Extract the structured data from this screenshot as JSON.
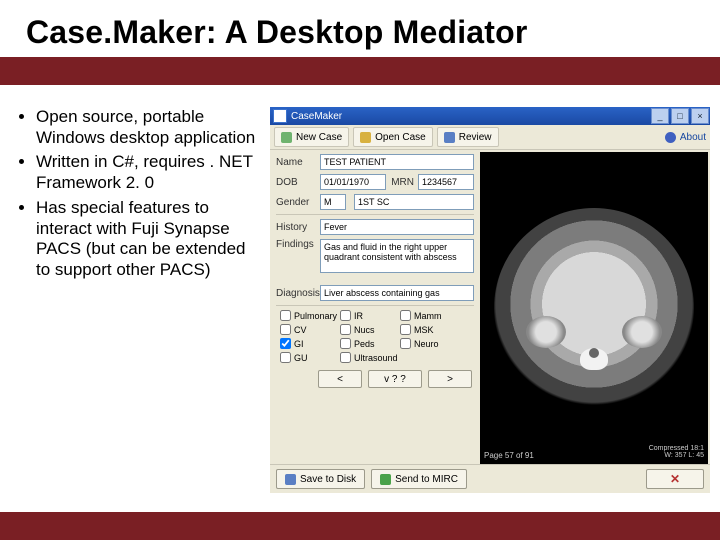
{
  "slide": {
    "title": "Case.Maker: A Desktop Mediator",
    "bullets": [
      "Open source, portable Windows desktop application",
      "Written in C#, requires . NET Framework 2. 0",
      "Has special features to interact with Fuji Synapse PACS (but can be extended to support other PACS)"
    ]
  },
  "colors": {
    "accent": "#7a1f24",
    "titlebar": "#1a49a3"
  },
  "app": {
    "titlebar": {
      "title": "CaseMaker",
      "minimize": "_",
      "maximize": "□",
      "close": "×"
    },
    "toolbar": {
      "new_case": "New Case",
      "open_case": "Open Case",
      "review": "Review",
      "about": "About",
      "icons": {
        "new": "#6fb36f",
        "open": "#d8b13f",
        "review": "#5a7fc4",
        "about": "#3f60c0"
      }
    },
    "form": {
      "name_label": "Name",
      "name_value": "TEST PATIENT",
      "dob_label": "DOB",
      "dob_value": "01/01/1970",
      "mrn_label": "MRN",
      "mrn_value": "1234567",
      "gender_label": "Gender",
      "gender_value": "M",
      "location_value": "1ST SC",
      "history_label": "History",
      "history_value": "Fever",
      "findings_label": "Findings",
      "findings_value": "Gas and fluid in the right upper quadrant consistent with abscess",
      "diagnosis_label": "Diagnosis",
      "diagnosis_value": "Liver abscess containing gas"
    },
    "categories": [
      {
        "label": "Pulmonary",
        "checked": false
      },
      {
        "label": "IR",
        "checked": false
      },
      {
        "label": "Mamm",
        "checked": false
      },
      {
        "label": "CV",
        "checked": false
      },
      {
        "label": "Nucs",
        "checked": false
      },
      {
        "label": "MSK",
        "checked": false
      },
      {
        "label": "GI",
        "checked": true
      },
      {
        "label": "Peds",
        "checked": false
      },
      {
        "label": "Neuro",
        "checked": false
      },
      {
        "label": "GU",
        "checked": false
      },
      {
        "label": "Ultrasound",
        "checked": false
      }
    ],
    "nav": {
      "prev": "<",
      "mid": "v ? ?",
      "next": ">"
    },
    "image": {
      "page": "Page 57 of 91",
      "meta1": "Compressed 18:1",
      "meta2": "W: 357 L: 45"
    },
    "status": {
      "save_disk": "Save to Disk",
      "send_mirc": "Send to MIRC",
      "cancel": "✕",
      "icons": {
        "disk": "#5a7fc4",
        "mirc": "#4aa24a"
      }
    }
  }
}
